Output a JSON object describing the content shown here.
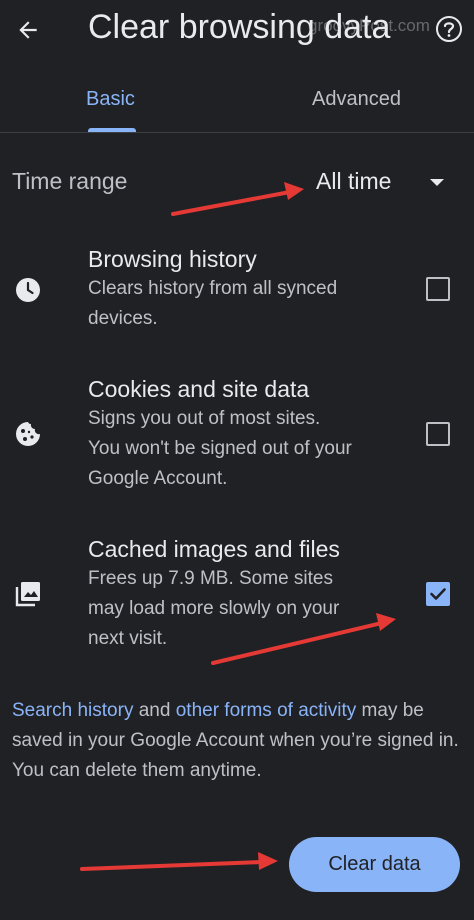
{
  "header": {
    "title": "Clear browsing data",
    "watermark": "groovyPost.com",
    "back_icon": "back-arrow-icon",
    "help_icon": "help-icon"
  },
  "tabs": [
    {
      "label": "Basic",
      "selected": true
    },
    {
      "label": "Advanced",
      "selected": false
    }
  ],
  "time_range": {
    "label": "Time range",
    "value": "All time"
  },
  "options": [
    {
      "title": "Browsing history",
      "desc": [
        "Clears history from all synced",
        "devices."
      ],
      "icon": "clock-icon",
      "checked": false
    },
    {
      "title": "Cookies and site data",
      "desc": [
        "Signs you out of most sites.",
        "You won't be signed out of your",
        "Google Account."
      ],
      "icon": "cookie-icon",
      "checked": false
    },
    {
      "title": "Cached images and files",
      "desc": [
        "Frees up 7.9 MB. Some sites",
        "may load more slowly on your",
        "next visit."
      ],
      "icon": "image-icon",
      "checked": true
    }
  ],
  "footer": {
    "link1": "Search history",
    "text1": " and ",
    "link2": "other forms of activity",
    "text2": " may be saved in your Google Account when you’re signed in. You can delete them anytime."
  },
  "action": {
    "clear_label": "Clear data"
  },
  "colors": {
    "background": "#202124",
    "accent": "#8ab4f8",
    "annotation_arrow": "#e53935"
  }
}
